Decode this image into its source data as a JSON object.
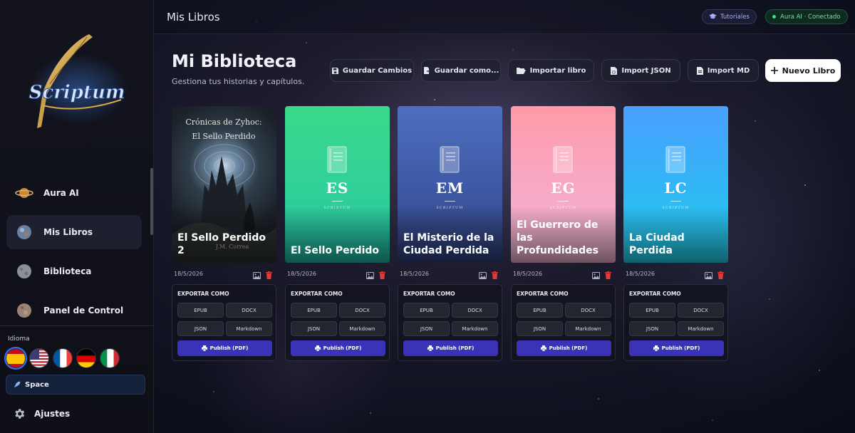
{
  "sidebar": {
    "logo_text": "Scriptum",
    "nav": [
      {
        "label": "Aura AI",
        "icon": "planet-icon"
      },
      {
        "label": "Mis Libros",
        "icon": "globe-books-icon"
      },
      {
        "label": "Biblioteca",
        "icon": "moon-icon"
      },
      {
        "label": "Panel de Control",
        "icon": "mars-icon"
      }
    ],
    "language_label": "Idioma",
    "languages": [
      "es",
      "en",
      "fr",
      "de",
      "it"
    ],
    "theme_label": "Space",
    "settings_label": "Ajustes"
  },
  "topbar": {
    "title": "Mis Libros",
    "tutorials_label": "Tutoriales",
    "ai_status_label": "Aura AI · Conectado"
  },
  "header": {
    "title": "Mi Biblioteca",
    "subtitle": "Gestiona tus historias y capítulos.",
    "buttons": {
      "save": "Guardar Cambios",
      "save_as": "Guardar como...",
      "import_book": "Importar libro",
      "import_json": "Import JSON",
      "import_md": "Import MD",
      "new_book": "Nuevo Libro"
    }
  },
  "cover_brand": "SCRIPTUM",
  "export": {
    "title": "EXPORTAR COMO",
    "epub": "EPUB",
    "docx": "DOCX",
    "json": "JSON",
    "markdown": "Markdown",
    "publish": "Publish (PDF)"
  },
  "books": [
    {
      "title": "El Sello Perdido 2",
      "date": "18/5/2026",
      "initials": "",
      "cover": "image",
      "cover_text_top": "Crónicas de Zyhoc:",
      "cover_text_sub": "El Sello Perdido",
      "cover_author": "J.M. Correa"
    },
    {
      "title": "El Sello Perdido",
      "date": "18/5/2026",
      "initials": "ES",
      "cover": "green"
    },
    {
      "title": "El Misterio de la Ciudad Perdida",
      "date": "18/5/2026",
      "initials": "EM",
      "cover": "blue"
    },
    {
      "title": "El Guerrero de las Profundidades",
      "date": "18/5/2026",
      "initials": "EG",
      "cover": "pink"
    },
    {
      "title": "La Ciudad Perdida",
      "date": "18/5/2026",
      "initials": "LC",
      "cover": "cyan"
    }
  ],
  "colors": {
    "accent_publish": "#3a33b8",
    "status_green": "#3ee27f",
    "delete_red": "#e53935"
  }
}
